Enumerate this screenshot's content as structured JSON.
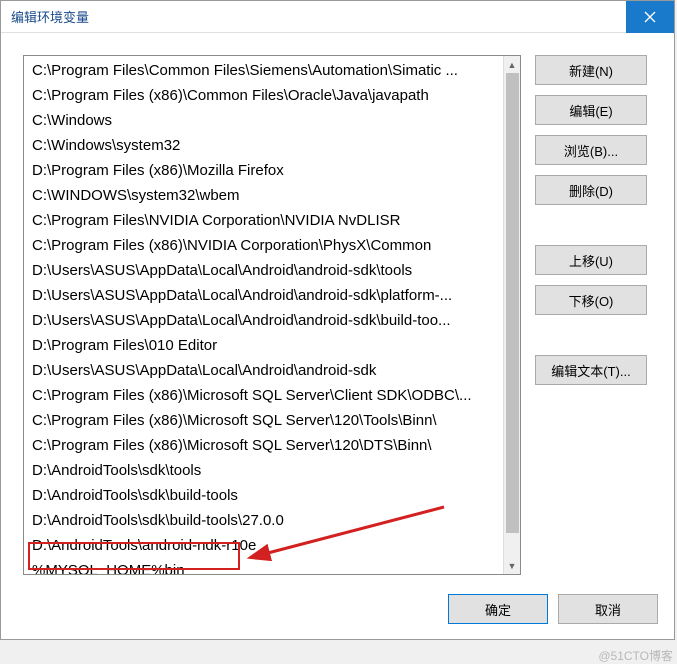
{
  "title": "编辑环境变量",
  "list_items": [
    "C:\\Program Files\\Common Files\\Siemens\\Automation\\Simatic ...",
    "C:\\Program Files (x86)\\Common Files\\Oracle\\Java\\javapath",
    "C:\\Windows",
    "C:\\Windows\\system32",
    "D:\\Program Files (x86)\\Mozilla Firefox",
    "C:\\WINDOWS\\system32\\wbem",
    "C:\\Program Files\\NVIDIA Corporation\\NVIDIA NvDLISR",
    "C:\\Program Files (x86)\\NVIDIA Corporation\\PhysX\\Common",
    "D:\\Users\\ASUS\\AppData\\Local\\Android\\android-sdk\\tools",
    "D:\\Users\\ASUS\\AppData\\Local\\Android\\android-sdk\\platform-...",
    "D:\\Users\\ASUS\\AppData\\Local\\Android\\android-sdk\\build-too...",
    "D:\\Program Files\\010 Editor",
    "D:\\Users\\ASUS\\AppData\\Local\\Android\\android-sdk",
    "C:\\Program Files (x86)\\Microsoft SQL Server\\Client SDK\\ODBC\\...",
    "C:\\Program Files (x86)\\Microsoft SQL Server\\120\\Tools\\Binn\\",
    "C:\\Program Files (x86)\\Microsoft SQL Server\\120\\DTS\\Binn\\",
    "D:\\AndroidTools\\sdk\\tools",
    "D:\\AndroidTools\\sdk\\build-tools",
    "D:\\AndroidTools\\sdk\\build-tools\\27.0.0",
    "D:\\AndroidTools\\android-ndk-r10e",
    "%MYSQL_HOME%bin"
  ],
  "buttons": {
    "new": "新建(N)",
    "edit": "编辑(E)",
    "browse": "浏览(B)...",
    "delete": "删除(D)",
    "move_up": "上移(U)",
    "move_down": "下移(O)",
    "edit_text": "编辑文本(T)...",
    "ok": "确定",
    "cancel": "取消"
  },
  "watermark": "@51CTO博客",
  "colors": {
    "titlebar_accent": "#1979ca",
    "highlight_border": "#d32020",
    "arrow_color": "#d32020"
  }
}
